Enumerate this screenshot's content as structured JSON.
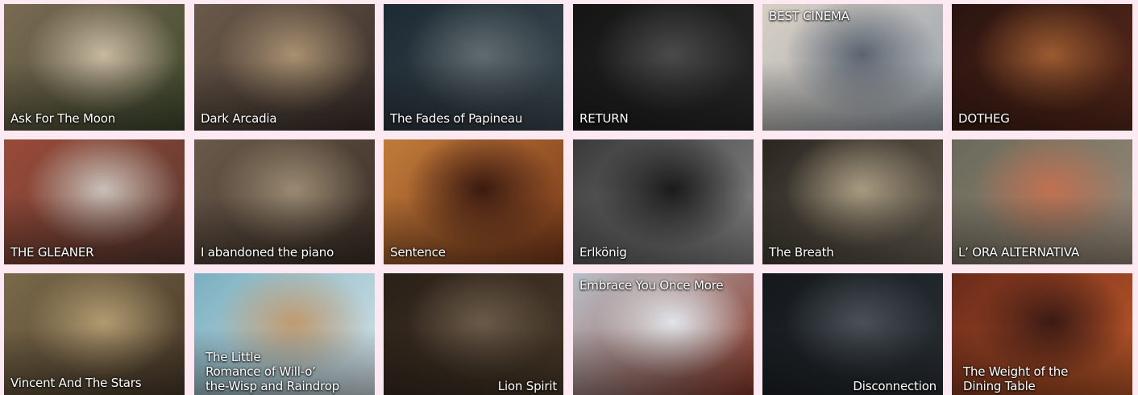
{
  "tiles": [
    {
      "title": "Ask For The Moon",
      "bg": [
        "#7a6a52",
        "#3f4a2e",
        "#c8b8a0"
      ],
      "caption_pos": "bl"
    },
    {
      "title": "Dark Arcadia",
      "bg": [
        "#6b5a4a",
        "#3a2f2a",
        "#a89070"
      ],
      "caption_pos": "bl"
    },
    {
      "title": "The Fades of Papineau",
      "bg": [
        "#1e2a33",
        "#3e4a52",
        "#5f6b6e"
      ],
      "caption_pos": "bl"
    },
    {
      "title": "RETURN",
      "bg": [
        "#151515",
        "#2a2a2a",
        "#4a4a4a"
      ],
      "caption_pos": "bl"
    },
    {
      "title": "BEST CINEMA",
      "bg": [
        "#d8cfc4",
        "#9aa4ae",
        "#5a6470"
      ],
      "caption_pos": "tl"
    },
    {
      "title": "DOTHEG",
      "bg": [
        "#2a1410",
        "#5a2a1a",
        "#9a5a30"
      ],
      "caption_pos": "bl"
    },
    {
      "title": "THE GLEANER",
      "bg": [
        "#9a4a38",
        "#5a3a30",
        "#c8c0b8"
      ],
      "caption_pos": "bl"
    },
    {
      "title": "I abandoned the piano",
      "bg": [
        "#6a5a4a",
        "#3a2e26",
        "#9a8a72"
      ],
      "caption_pos": "bl"
    },
    {
      "title": "Sentence",
      "bg": [
        "#c07a3a",
        "#7a3a1a",
        "#3a1a10"
      ],
      "caption_pos": "bl"
    },
    {
      "title": "Erlkönig",
      "bg": [
        "#3a3a3a",
        "#8a8a8a",
        "#1a1a1a"
      ],
      "caption_pos": "bl"
    },
    {
      "title": "The Breath",
      "bg": [
        "#2a2620",
        "#6a6254",
        "#a89a80"
      ],
      "caption_pos": "bl"
    },
    {
      "title": "L’ ORA ALTERNATIVA",
      "bg": [
        "#6a6a5a",
        "#9a8a7a",
        "#c07050"
      ],
      "caption_pos": "bl"
    },
    {
      "title": "Vincent And The Stars",
      "bg": [
        "#7a6a4a",
        "#4a3a2a",
        "#b09a70"
      ],
      "caption_pos": "bl"
    },
    {
      "title": "The Little\nRomance of Will-o’\nthe-Wisp and Raindrop",
      "bg": [
        "#7ab0c0",
        "#d8e4e8",
        "#c09a70"
      ],
      "caption_pos": "bl-ml"
    },
    {
      "title": "Lion Spirit",
      "bg": [
        "#2a2018",
        "#4a3a2a",
        "#6a5a48"
      ],
      "caption_pos": "br"
    },
    {
      "title": "Embrace You Once More",
      "bg": [
        "#b8c0c8",
        "#8a3a2a",
        "#e0e4e8"
      ],
      "caption_pos": "tl"
    },
    {
      "title": "Disconnection",
      "bg": [
        "#14181c",
        "#2a3036",
        "#4a5056"
      ],
      "caption_pos": "br"
    },
    {
      "title": "The Weight of the\nDining Table",
      "bg": [
        "#6a2a1a",
        "#c05a2a",
        "#3a1a14"
      ],
      "caption_pos": "bl-ml"
    }
  ]
}
